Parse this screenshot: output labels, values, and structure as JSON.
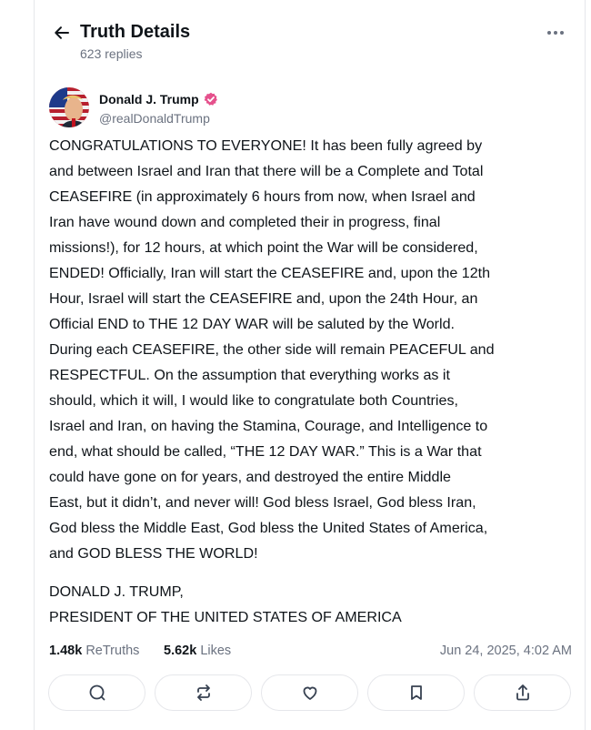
{
  "header": {
    "title": "Truth Details",
    "replies": "623 replies"
  },
  "author": {
    "name": "Donald J. Trump",
    "handle": "@realDonaldTrump",
    "verified": true
  },
  "post": {
    "paragraphs": [
      "CONGRATULATIONS TO EVERYONE! It has been fully agreed by\nand between Israel and Iran that there will be a Complete and Total\nCEASEFIRE (in approximately 6 hours from now, when Israel and\nIran have wound down and completed their in progress, final\nmissions!), for 12 hours, at which point the War will be considered,\nENDED! Officially, Iran will start the CEASEFIRE and, upon the 12th\nHour, Israel will start the CEASEFIRE and, upon the 24th Hour, an\nOfficial END to THE 12 DAY WAR will be saluted by the World.\nDuring each CEASEFIRE, the other side will remain PEACEFUL and\nRESPECTFUL. On the assumption that everything works as it\nshould, which it will, I would like to congratulate both Countries,\nIsrael and Iran, on having the Stamina, Courage, and Intelligence to\nend, what should be called, “THE 12 DAY WAR.” This is a War that\ncould have gone on for years, and destroyed the entire Middle\nEast, but it didn’t, and never will! God bless Israel, God bless Iran,\nGod bless the Middle East, God bless the United States of America,\nand GOD BLESS THE WORLD!",
      "DONALD J. TRUMP,\nPRESIDENT OF THE UNITED STATES OF AMERICA"
    ]
  },
  "stats": {
    "retruths_count": "1.48k",
    "retruths_label": "ReTruths",
    "likes_count": "5.62k",
    "likes_label": "Likes",
    "date": "Jun 24, 2025, 4:02 AM"
  },
  "actions": [
    {
      "icon": "reply-icon"
    },
    {
      "icon": "retruth-icon"
    },
    {
      "icon": "like-icon"
    },
    {
      "icon": "bookmark-icon"
    },
    {
      "icon": "share-icon"
    }
  ],
  "colors": {
    "text": "#0f1419",
    "muted": "#6b7280",
    "border": "#e6e7eb",
    "verified": "#e5518c"
  }
}
